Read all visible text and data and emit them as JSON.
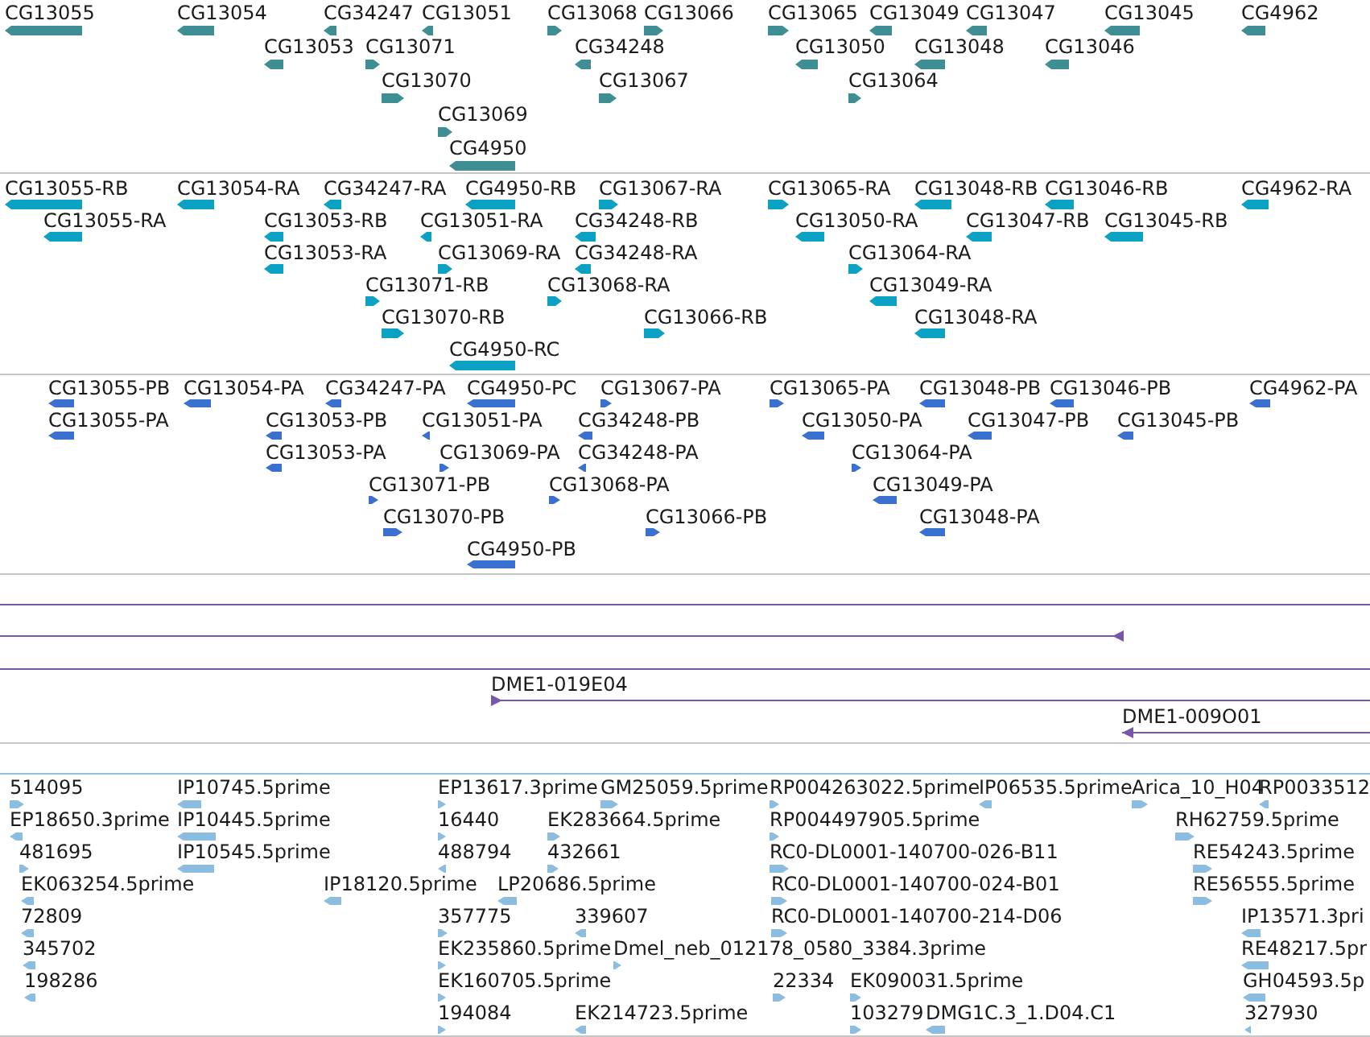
{
  "tracks": [
    {
      "kind": "gene",
      "features": [
        {
          "label": "CG13055",
          "reverse": true
        },
        {
          "label": "CG13054",
          "reverse": true
        },
        {
          "label": "CG34247",
          "reverse": true
        },
        {
          "label": "CG13051",
          "reverse": true
        },
        {
          "label": "CG13068",
          "reverse": false
        },
        {
          "label": "CG13066",
          "reverse": false
        },
        {
          "label": "CG13065",
          "reverse": false
        },
        {
          "label": "CG13049",
          "reverse": true
        },
        {
          "label": "CG13047",
          "reverse": true
        },
        {
          "label": "CG13045",
          "reverse": true
        },
        {
          "label": "CG4962",
          "reverse": true
        },
        {
          "label": "CG13053",
          "reverse": true
        },
        {
          "label": "CG13071",
          "reverse": false
        },
        {
          "label": "CG34248",
          "reverse": true
        },
        {
          "label": "CG13050",
          "reverse": true
        },
        {
          "label": "CG13048",
          "reverse": true
        },
        {
          "label": "CG13046",
          "reverse": true
        },
        {
          "label": "CG13070",
          "reverse": false
        },
        {
          "label": "CG13067",
          "reverse": false
        },
        {
          "label": "CG13064",
          "reverse": false
        },
        {
          "label": "CG13069",
          "reverse": false
        },
        {
          "label": "CG4950",
          "reverse": true
        }
      ]
    },
    {
      "kind": "transcript",
      "features": [
        {
          "label": "CG13055-RB",
          "reverse": true
        },
        {
          "label": "CG13054-RA",
          "reverse": true
        },
        {
          "label": "CG34247-RA",
          "reverse": true
        },
        {
          "label": "CG4950-RB",
          "reverse": true
        },
        {
          "label": "CG13067-RA",
          "reverse": false
        },
        {
          "label": "CG13065-RA",
          "reverse": false
        },
        {
          "label": "CG13048-RB",
          "reverse": true
        },
        {
          "label": "CG13046-RB",
          "reverse": true
        },
        {
          "label": "CG4962-RA",
          "reverse": true
        },
        {
          "label": "CG13055-RA",
          "reverse": true
        },
        {
          "label": "CG13053-RB",
          "reverse": true
        },
        {
          "label": "CG13051-RA",
          "reverse": true
        },
        {
          "label": "CG34248-RB",
          "reverse": true
        },
        {
          "label": "CG13050-RA",
          "reverse": true
        },
        {
          "label": "CG13047-RB",
          "reverse": true
        },
        {
          "label": "CG13045-RB",
          "reverse": true
        },
        {
          "label": "CG13053-RA",
          "reverse": true
        },
        {
          "label": "CG13069-RA",
          "reverse": false
        },
        {
          "label": "CG34248-RA",
          "reverse": true
        },
        {
          "label": "CG13064-RA",
          "reverse": false
        },
        {
          "label": "CG13071-RB",
          "reverse": false
        },
        {
          "label": "CG13068-RA",
          "reverse": false
        },
        {
          "label": "CG13049-RA",
          "reverse": true
        },
        {
          "label": "CG13070-RB",
          "reverse": false
        },
        {
          "label": "CG13066-RB",
          "reverse": false
        },
        {
          "label": "CG13048-RA",
          "reverse": true
        },
        {
          "label": "CG4950-RC",
          "reverse": true
        }
      ]
    },
    {
      "kind": "protein",
      "features": [
        {
          "label": "CG13055-PB",
          "reverse": true
        },
        {
          "label": "CG13054-PA",
          "reverse": true
        },
        {
          "label": "CG34247-PA",
          "reverse": true
        },
        {
          "label": "CG4950-PC",
          "reverse": true
        },
        {
          "label": "CG13067-PA",
          "reverse": false
        },
        {
          "label": "CG13065-PA",
          "reverse": false
        },
        {
          "label": "CG13048-PB",
          "reverse": true
        },
        {
          "label": "CG13046-PB",
          "reverse": true
        },
        {
          "label": "CG4962-PA",
          "reverse": true
        },
        {
          "label": "CG13055-PA",
          "reverse": true
        },
        {
          "label": "CG13053-PB",
          "reverse": true
        },
        {
          "label": "CG13051-PA",
          "reverse": true
        },
        {
          "label": "CG34248-PB",
          "reverse": true
        },
        {
          "label": "CG13050-PA",
          "reverse": true
        },
        {
          "label": "CG13047-PB",
          "reverse": true
        },
        {
          "label": "CG13045-PB",
          "reverse": true
        },
        {
          "label": "CG13053-PA",
          "reverse": true
        },
        {
          "label": "CG13069-PA",
          "reverse": false
        },
        {
          "label": "CG34248-PA",
          "reverse": true
        },
        {
          "label": "CG13064-PA",
          "reverse": false
        },
        {
          "label": "CG13071-PB",
          "reverse": false
        },
        {
          "label": "CG13068-PA",
          "reverse": false
        },
        {
          "label": "CG13049-PA",
          "reverse": true
        },
        {
          "label": "CG13070-PB",
          "reverse": false
        },
        {
          "label": "CG13066-PB",
          "reverse": false
        },
        {
          "label": "CG13048-PA",
          "reverse": true
        },
        {
          "label": "CG4950-PB",
          "reverse": true
        }
      ]
    },
    {
      "kind": "clone",
      "features": [
        {
          "marker": false
        },
        {
          "marker": true,
          "reverse": true
        },
        {
          "marker": false
        },
        {
          "label": "DME1-019E04",
          "marker": true,
          "reverse": false
        },
        {
          "label": "DME1-009O01",
          "marker": true,
          "reverse": true
        }
      ]
    },
    {
      "kind": "est",
      "features": [
        {
          "label": "514095",
          "reverse": false
        },
        {
          "label": "IP10745.5prime",
          "reverse": true
        },
        {
          "label": "EP13617.3prime",
          "reverse": false
        },
        {
          "label": "GM25059.5prime",
          "reverse": false
        },
        {
          "label": "RP004263022.5prime",
          "reverse": false
        },
        {
          "label": "IP06535.5prime",
          "reverse": true
        },
        {
          "label": "Arica_10_H04",
          "reverse": false
        },
        {
          "label": "RP0033512",
          "reverse": true
        },
        {
          "label": "EP18650.3prime",
          "reverse": true
        },
        {
          "label": "IP10445.5prime",
          "reverse": true
        },
        {
          "label": "16440",
          "reverse": false
        },
        {
          "label": "EK283664.5prime",
          "reverse": false
        },
        {
          "label": "RP004497905.5prime",
          "reverse": false
        },
        {
          "label": "RH62759.5prime",
          "reverse": false
        },
        {
          "label": "481695",
          "reverse": false
        },
        {
          "label": "IP10545.5prime",
          "reverse": true
        },
        {
          "label": "488794",
          "reverse": true
        },
        {
          "label": "432661",
          "reverse": false
        },
        {
          "label": "RC0-DL0001-140700-026-B11",
          "reverse": false
        },
        {
          "label": "RE54243.5prime",
          "reverse": false
        },
        {
          "label": "EK063254.5prime",
          "reverse": true
        },
        {
          "label": "IP18120.5prime",
          "reverse": true
        },
        {
          "label": "LP20686.5prime",
          "reverse": true
        },
        {
          "label": "RC0-DL0001-140700-024-B01",
          "reverse": false
        },
        {
          "label": "RE56555.5prime",
          "reverse": false
        },
        {
          "label": "72809",
          "reverse": true
        },
        {
          "label": "357775",
          "reverse": false
        },
        {
          "label": "339607",
          "reverse": true
        },
        {
          "label": "RC0-DL0001-140700-214-D06",
          "reverse": false
        },
        {
          "label": "IP13571.3pri",
          "reverse": true
        },
        {
          "label": "345702",
          "reverse": true
        },
        {
          "label": "EK235860.5prime",
          "reverse": false
        },
        {
          "label": "Dmel_neb_012178_0580_3384.3prime",
          "reverse": false
        },
        {
          "label": "RE48217.5pr",
          "reverse": true
        },
        {
          "label": "198286",
          "reverse": true
        },
        {
          "label": "EK160705.5prime",
          "reverse": false
        },
        {
          "label": "22334",
          "reverse": false
        },
        {
          "label": "EK090031.5prime",
          "reverse": false
        },
        {
          "label": "GH04593.5p",
          "reverse": true
        },
        {
          "label": "194084",
          "reverse": false
        },
        {
          "label": "EK214723.5prime",
          "reverse": true
        },
        {
          "label": "103279",
          "reverse": false
        },
        {
          "label": "DMG1C.3_1.D04.C1",
          "reverse": true
        },
        {
          "label": "327930",
          "reverse": true
        }
      ]
    }
  ]
}
